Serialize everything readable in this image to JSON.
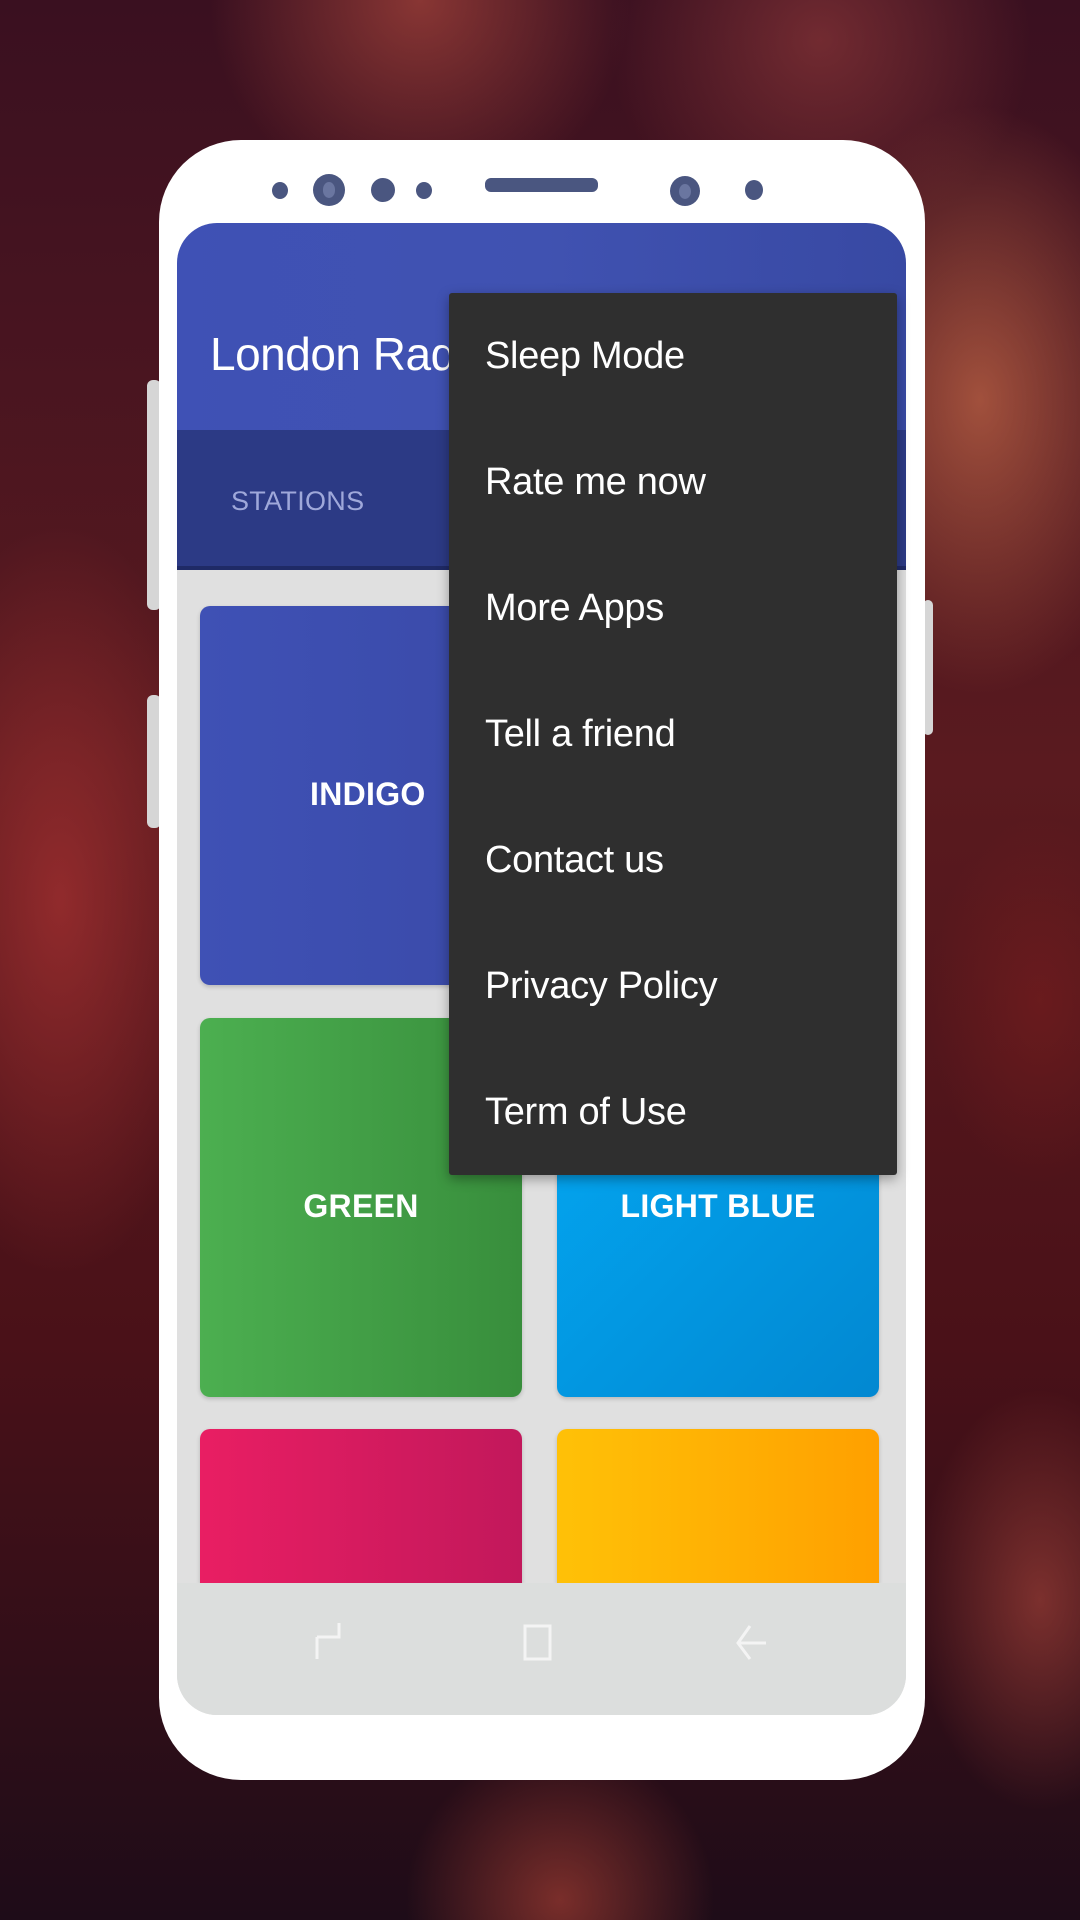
{
  "app": {
    "title": "London Radio",
    "title_visible": "London Rad"
  },
  "tabs": [
    {
      "label": "STATIONS",
      "selected": false
    }
  ],
  "cards": [
    {
      "label": "INDIGO",
      "color": "#3F51B5"
    },
    {
      "label": "",
      "color": "#3F51B5"
    },
    {
      "label": "GREEN",
      "color": "#4CAF50"
    },
    {
      "label": "LIGHT BLUE",
      "color": "#03A9F4"
    },
    {
      "label": "",
      "color": "#E91E63"
    },
    {
      "label": "",
      "color": "#FFC107"
    }
  ],
  "overflow_menu": {
    "items": [
      {
        "label": "Sleep Mode"
      },
      {
        "label": "Rate me now"
      },
      {
        "label": "More Apps"
      },
      {
        "label": "Tell a friend"
      },
      {
        "label": "Contact us"
      },
      {
        "label": "Privacy Policy"
      },
      {
        "label": "Term of Use"
      }
    ]
  },
  "navbar": {
    "icons": [
      "recents-icon",
      "home-icon",
      "back-icon"
    ]
  },
  "colors": {
    "primary": "#3F51B5",
    "tab_bar": "#2C3A85",
    "menu_bg": "#2F2F2F",
    "grid_bg": "#E0E0E0"
  }
}
